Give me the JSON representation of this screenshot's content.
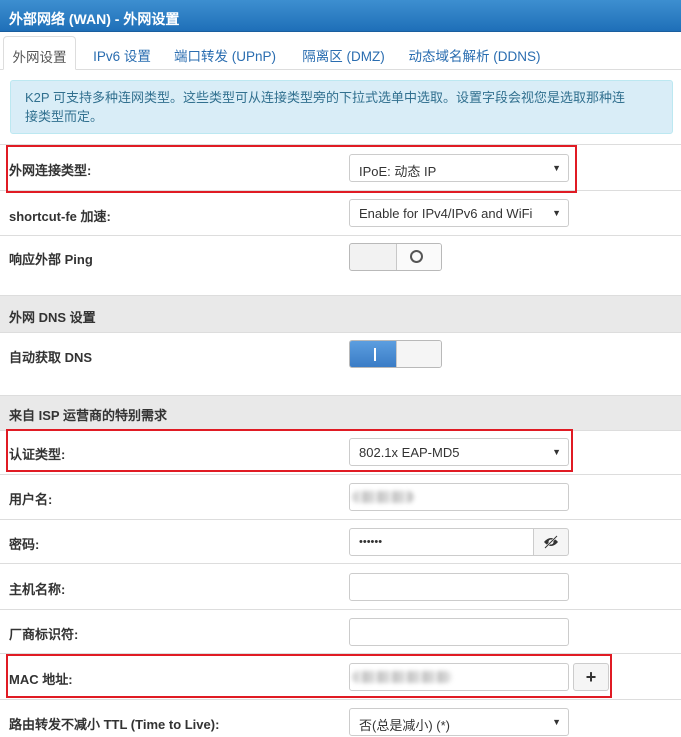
{
  "header": {
    "title": "外部网络 (WAN) - 外网设置"
  },
  "tabs": [
    {
      "label": "外网设置",
      "active": true
    },
    {
      "label": "IPv6 设置"
    },
    {
      "label": "端口转发 (UPnP)"
    },
    {
      "label": "隔离区 (DMZ)"
    },
    {
      "label": "动态域名解析 (DDNS)"
    }
  ],
  "info": {
    "line1": "K2P 可支持多种连网类型。这些类型可从连接类型旁的下拉式选单中选取。设置字段会视您是选取那种连",
    "line2": "接类型而定。"
  },
  "wan": {
    "conn_type_label": "外网连接类型:",
    "conn_type_value": "IPoE: 动态 IP",
    "shortcut_label": "shortcut-fe 加速:",
    "shortcut_value": "Enable for IPv4/IPv6 and WiFi",
    "ping_label": "响应外部 Ping",
    "ping_enabled": false
  },
  "dns": {
    "section_title": "外网 DNS 设置",
    "auto_dns_label": "自动获取 DNS",
    "auto_dns_enabled": true
  },
  "isp": {
    "section_title": "来自 ISP 运营商的特别需求",
    "auth_label": "认证类型:",
    "auth_value": "802.1x EAP-MD5",
    "username_label": "用户名:",
    "password_label": "密码:",
    "password_value": "••••••",
    "hostname_label": "主机名称:",
    "vendor_label": "厂商标识符:",
    "mac_label": "MAC 地址:",
    "ttl_label": "路由转发不减小 TTL (Time to Live):",
    "ttl_value": "否(总是减小) (*)"
  },
  "icons": {
    "dropdown": "caret-down-icon",
    "eye": "eye-slash-icon",
    "plus": "plus-icon"
  },
  "colors": {
    "header": "#1f6fb8",
    "highlight": "#e01b24",
    "toggle_on": "#3a7cc6",
    "info_bg": "#d9edf7"
  }
}
